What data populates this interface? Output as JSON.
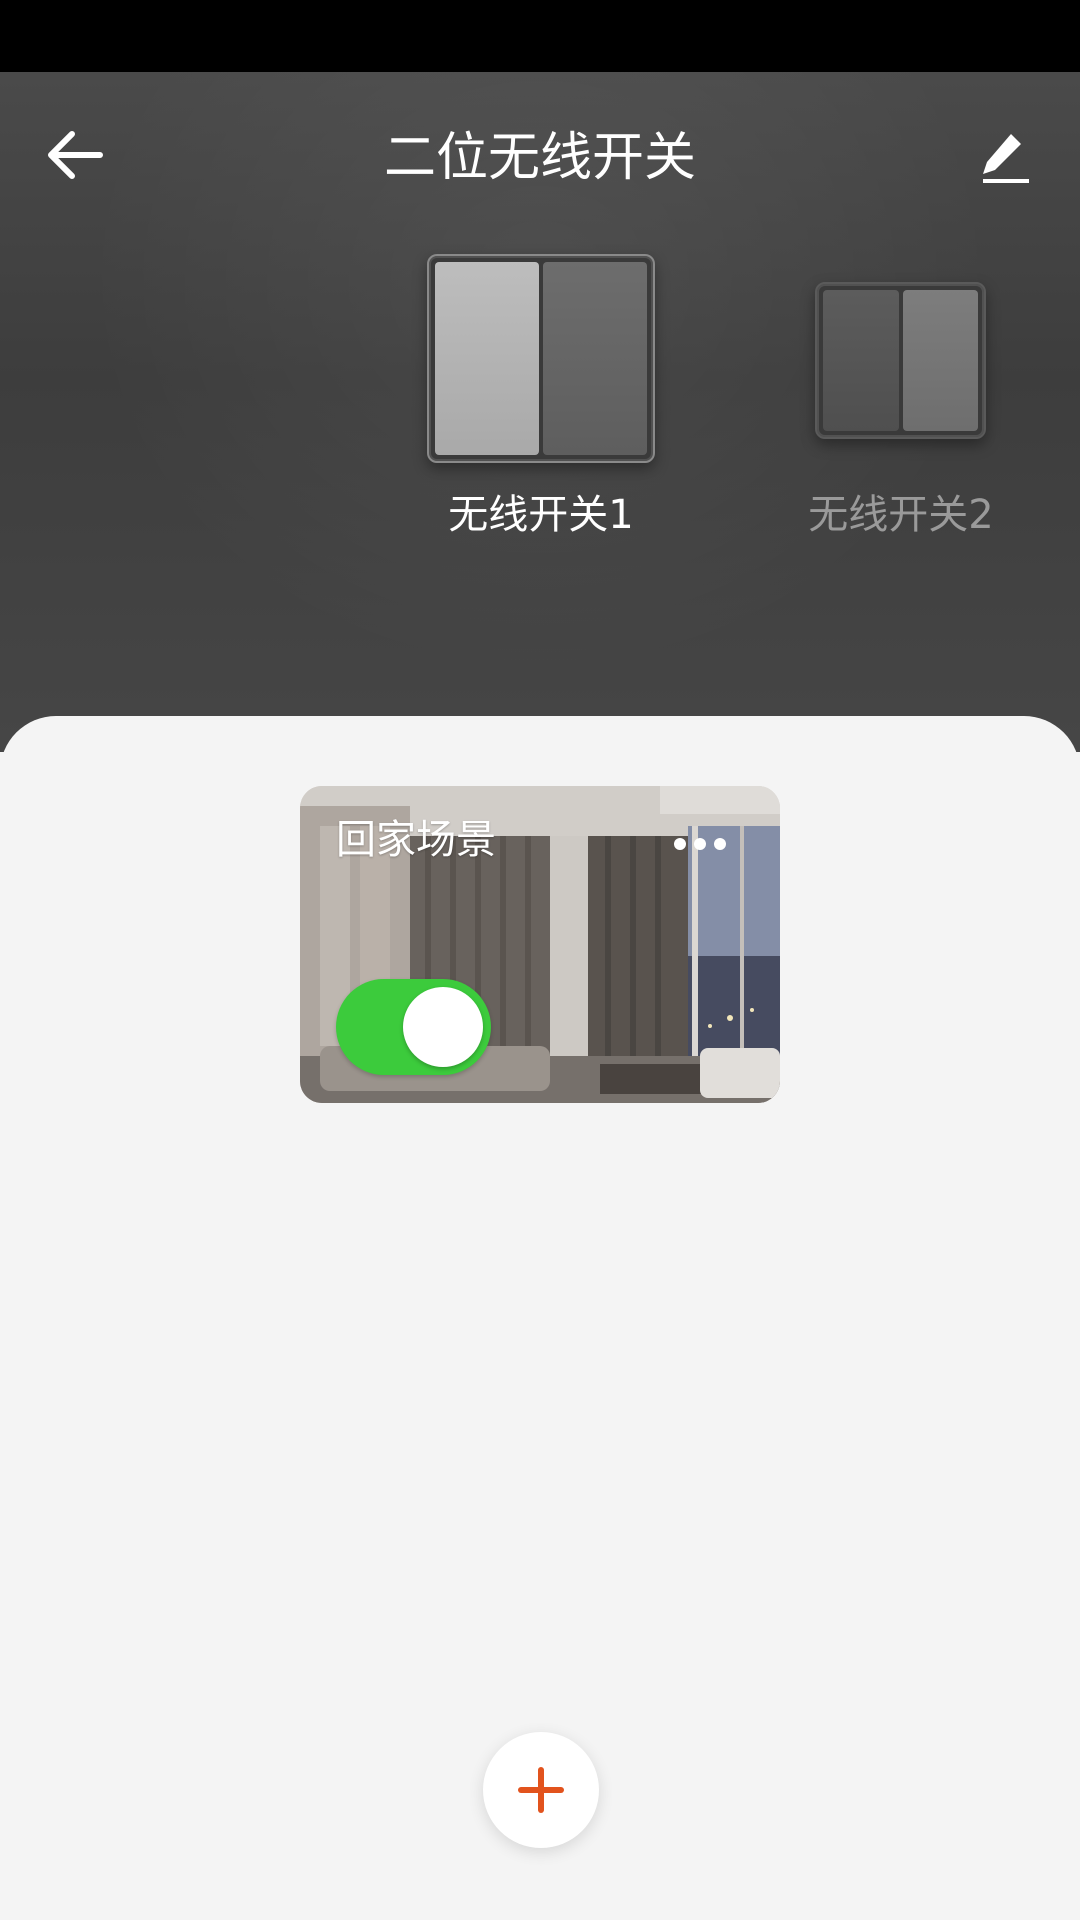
{
  "header": {
    "title": "二位无线开关"
  },
  "switches": [
    {
      "label": "无线开关1",
      "selected": true
    },
    {
      "label": "无线开关2",
      "selected": false
    }
  ],
  "scenes": [
    {
      "title": "回家场景",
      "enabled": true
    }
  ],
  "colors": {
    "toggle_on": "#3ccb3c",
    "add_accent": "#e2531d"
  },
  "icons": {
    "back": "arrow-left-icon",
    "edit": "pencil-icon",
    "more": "more-dots-icon",
    "add": "plus-icon"
  }
}
